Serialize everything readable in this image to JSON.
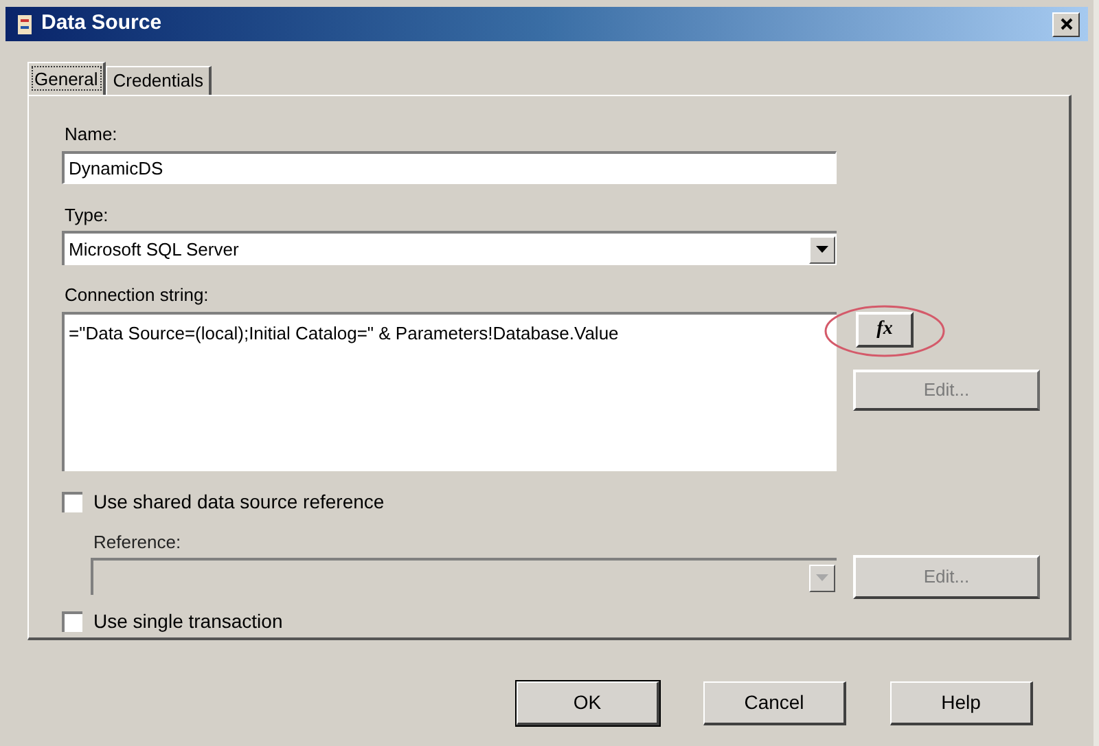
{
  "window": {
    "title": "Data Source"
  },
  "tabs": [
    {
      "label": "General",
      "selected": true
    },
    {
      "label": "Credentials",
      "selected": false
    }
  ],
  "name": {
    "label": "Name:",
    "value": "DynamicDS"
  },
  "type": {
    "label": "Type:",
    "value": "Microsoft SQL Server"
  },
  "connection": {
    "label": "Connection string:",
    "value": "=\"Data Source=(local);Initial Catalog=\" & Parameters!Database.Value",
    "expression_button": "fx",
    "edit_button": {
      "label": "Edit...",
      "disabled": true
    }
  },
  "shared_reference": {
    "label": "Use shared data source reference",
    "checked": false
  },
  "reference": {
    "label": "Reference:",
    "disabled": true,
    "edit_button": {
      "label": "Edit...",
      "disabled": true
    }
  },
  "single_transaction": {
    "label": "Use single transaction",
    "checked": false
  },
  "buttons": [
    {
      "label": "OK",
      "default": true
    },
    {
      "label": "Cancel",
      "default": false
    },
    {
      "label": "Help",
      "default": false
    }
  ]
}
